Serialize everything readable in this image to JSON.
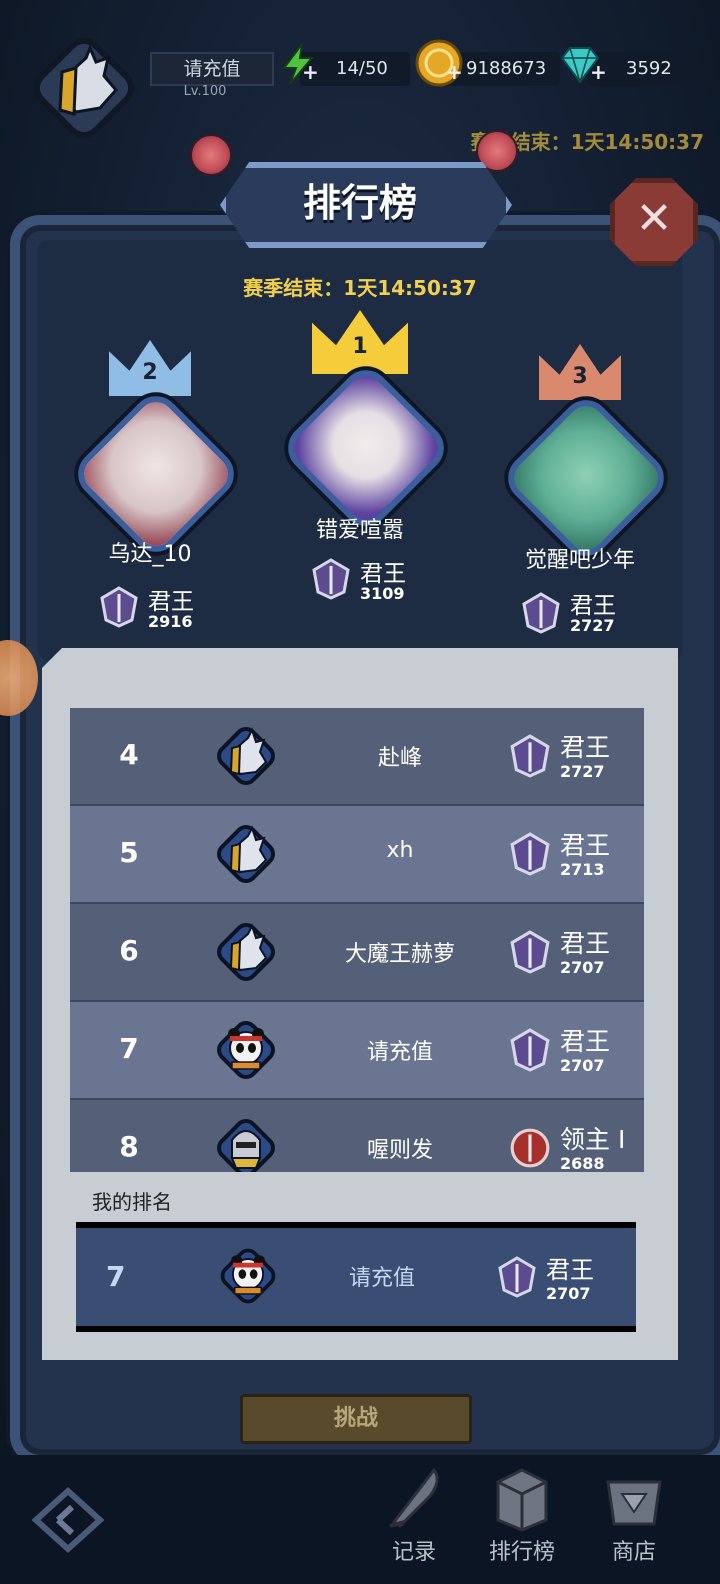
{
  "hud": {
    "player_name": "请充值",
    "level": "Lv.100",
    "energy": "14/50",
    "gold": "9188673",
    "gems": "3592",
    "season_timer_bg": "赛季结束：1天14:50:37"
  },
  "title": "排行榜",
  "season_timer": "赛季结束：1天14:50:37",
  "podium": [
    {
      "rank": "2",
      "name": "乌达_10",
      "title": "君王",
      "score": "2916",
      "crown_color": "#8fbde6"
    },
    {
      "rank": "1",
      "name": "错爱喧嚣",
      "title": "君王",
      "score": "3109",
      "crown_color": "#f5cc3a"
    },
    {
      "rank": "3",
      "name": "觉醒吧少年",
      "title": "君王",
      "score": "2727",
      "crown_color": "#d98a6e"
    }
  ],
  "list": [
    {
      "rank": "4",
      "name": "赴峰",
      "title": "君王",
      "score": "2727",
      "avatar": "dragon-knight"
    },
    {
      "rank": "5",
      "name": "xh",
      "title": "君王",
      "score": "2713",
      "avatar": "dragon-knight"
    },
    {
      "rank": "6",
      "name": "大魔王赫萝",
      "title": "君王",
      "score": "2707",
      "avatar": "dragon-knight"
    },
    {
      "rank": "7",
      "name": "请充值",
      "title": "君王",
      "score": "2707",
      "avatar": "panda"
    },
    {
      "rank": "8",
      "name": "喔则发",
      "title": "领主 I",
      "score": "2688",
      "avatar": "knight-helmet"
    }
  ],
  "my_rank": {
    "label": "我的排名",
    "rank": "7",
    "name": "请充值",
    "title": "君王",
    "score": "2707"
  },
  "challenge_button": "挑战",
  "nav": [
    {
      "label": "记录",
      "icon": "quill-icon"
    },
    {
      "label": "排行榜",
      "icon": "trophy-box-icon"
    },
    {
      "label": "商店",
      "icon": "shop-gem-icon"
    }
  ],
  "colors": {
    "accent_gold": "#f2d04e",
    "row_dark": "#546078",
    "row_light": "#6a7591",
    "my_row": "#3a4d73"
  }
}
